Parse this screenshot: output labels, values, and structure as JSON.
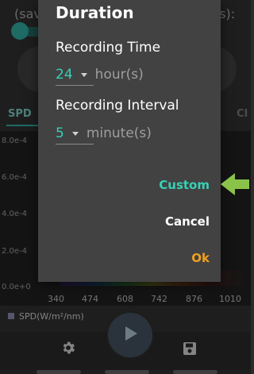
{
  "background": {
    "top_left_text": "(sav",
    "top_right_text": "ds):",
    "tab_left": "SPD",
    "tab_right": "CI",
    "y_ticks": [
      "8.0e-4",
      "6.0e-4",
      "4.0e-4",
      "2.0e-4",
      "0.0e+0"
    ],
    "x_ticks": [
      "340",
      "474",
      "608",
      "742",
      "876",
      "1010"
    ],
    "legend_label": "SPD(W/m²/nm)"
  },
  "dialog": {
    "title": "Duration",
    "recording_time_label": "Recording Time",
    "recording_time_value": "24",
    "recording_time_unit": "hour(s)",
    "recording_interval_label": "Recording Interval",
    "recording_interval_value": "5",
    "recording_interval_unit": "minute(s)",
    "custom_label": "Custom",
    "cancel_label": "Cancel",
    "ok_label": "Ok"
  },
  "icons": {
    "play": "play-icon",
    "settings": "gear-icon",
    "save": "save-icon",
    "annotation": "arrow-icon"
  },
  "colors": {
    "accent": "#36d1b6",
    "ok": "#f0a020",
    "annotation_arrow": "#8bc34a"
  }
}
